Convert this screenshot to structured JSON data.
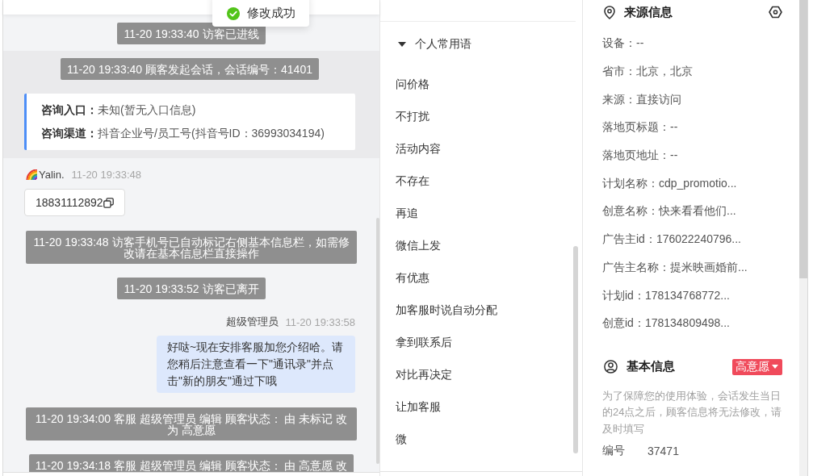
{
  "toast": {
    "message": "修改成功"
  },
  "chat": {
    "messages": [
      {
        "kind": "system",
        "text": "11-20 19:33:40 访客已进线"
      },
      {
        "kind": "session",
        "text": "11-20 19:33:40 顾客发起会话，会话编号：41401",
        "fields": [
          {
            "label": "咨询入口：",
            "value": "未知(暂无入口信息)"
          },
          {
            "label": "咨询渠道：",
            "value": "抖音企业号/员工号(抖音号ID：36993034194)"
          }
        ]
      },
      {
        "kind": "visitor",
        "sender": "Yalin.",
        "time": "11-20 19:33:48",
        "text": "18831112892"
      },
      {
        "kind": "system",
        "text": "11-20 19:33:48 访客手机号已自动标记右侧基本信息栏，如需修改请在基本信息栏直接操作"
      },
      {
        "kind": "system",
        "text": "11-20 19:33:52 访客已离开"
      },
      {
        "kind": "agent",
        "sender": "超级管理员",
        "time": "11-20 19:33:58",
        "text": "好哒~现在安排客服加您介绍哈。请您稍后注意查看一下\"通讯录\"并点击\"新的朋友\"通过下哦"
      },
      {
        "kind": "system",
        "text": "11-20 19:34:00 客服 超级管理员 编辑 顾客状态： 由 未标记 改为 高意愿"
      },
      {
        "kind": "system",
        "text": "11-20 19:34:18 客服 超级管理员 编辑 顾客状态： 由 高意愿 改"
      }
    ]
  },
  "phrases": {
    "group_title": "个人常用语",
    "expanded": true,
    "items": [
      "问价格",
      "不打扰",
      "活动内容",
      "不存在",
      "再追",
      "微信上发",
      "有优惠",
      "加客服时说自动分配",
      "拿到联系后",
      "对比再决定",
      "让加客服",
      "微"
    ]
  },
  "source_info": {
    "title": "来源信息",
    "rows": [
      "设备：--",
      "省市：北京，北京",
      "来源：直接访问",
      "落地页标题：--",
      "落地页地址：--",
      "计划名称：cdp_promotio...",
      "创意名称：快来看看他们...",
      "广告主id：176022240796...",
      "广告主名称：提米映画婚前...",
      "计划id：178134768772...",
      "创意id：178134809498..."
    ]
  },
  "basic_info": {
    "title": "基本信息",
    "status": "高意愿",
    "notice": "为了保障您的使用体验，会话发生当日的24点之后，顾客信息将无法修改，请及时填写",
    "fields": [
      {
        "label": "编号",
        "value": "37471"
      }
    ]
  }
}
